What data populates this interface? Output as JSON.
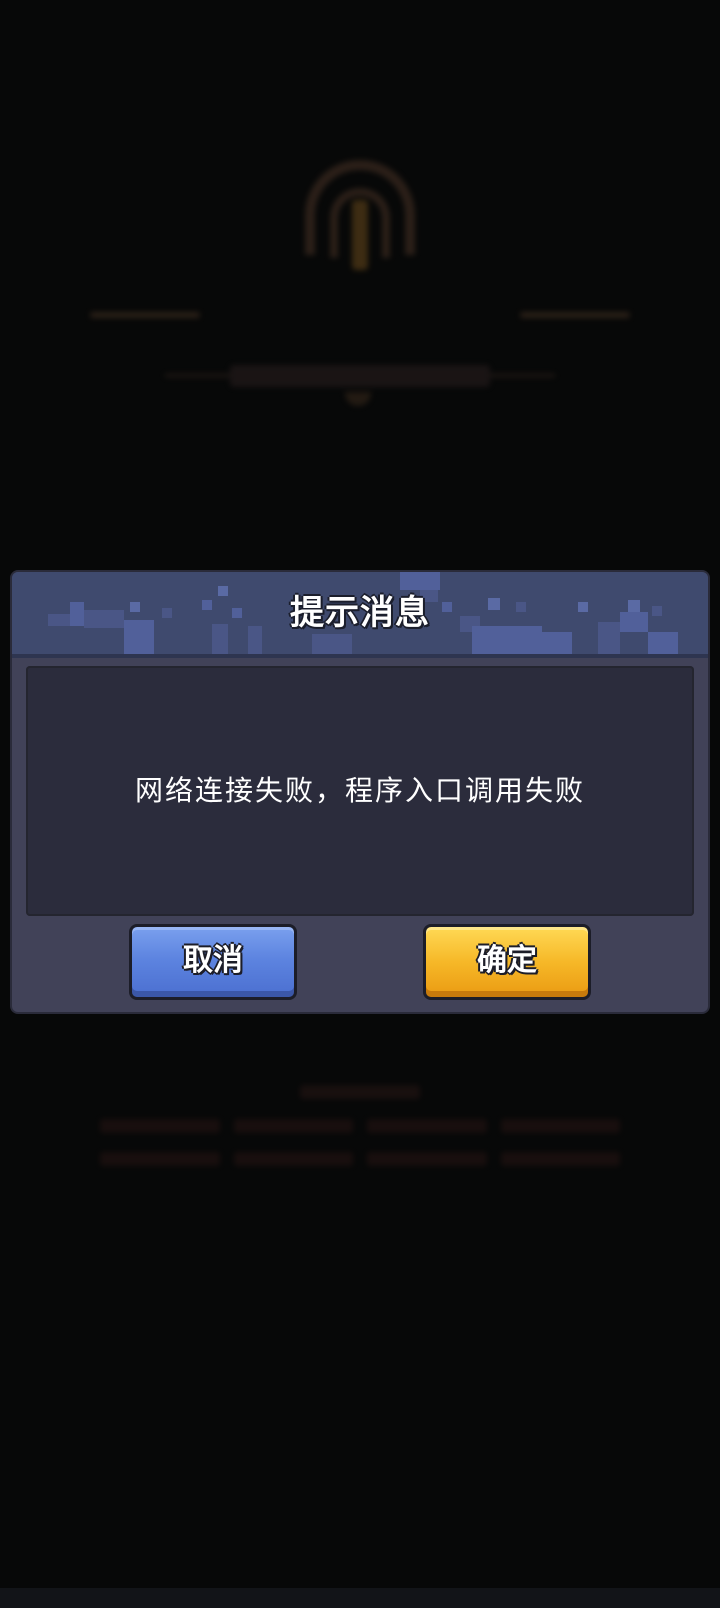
{
  "dialog": {
    "title": "提示消息",
    "message": "网络连接失败，程序入口调用失败",
    "cancel_label": "取消",
    "confirm_label": "确定"
  },
  "colors": {
    "background": "#060707",
    "dialog_frame": "#414258",
    "dialog_header": "#3f4a6e",
    "content_panel": "#2b2c3c",
    "cancel_button": "#5d84e0",
    "confirm_button": "#f6b828"
  },
  "icons": {
    "game_logo": "game-logo-blurred"
  }
}
